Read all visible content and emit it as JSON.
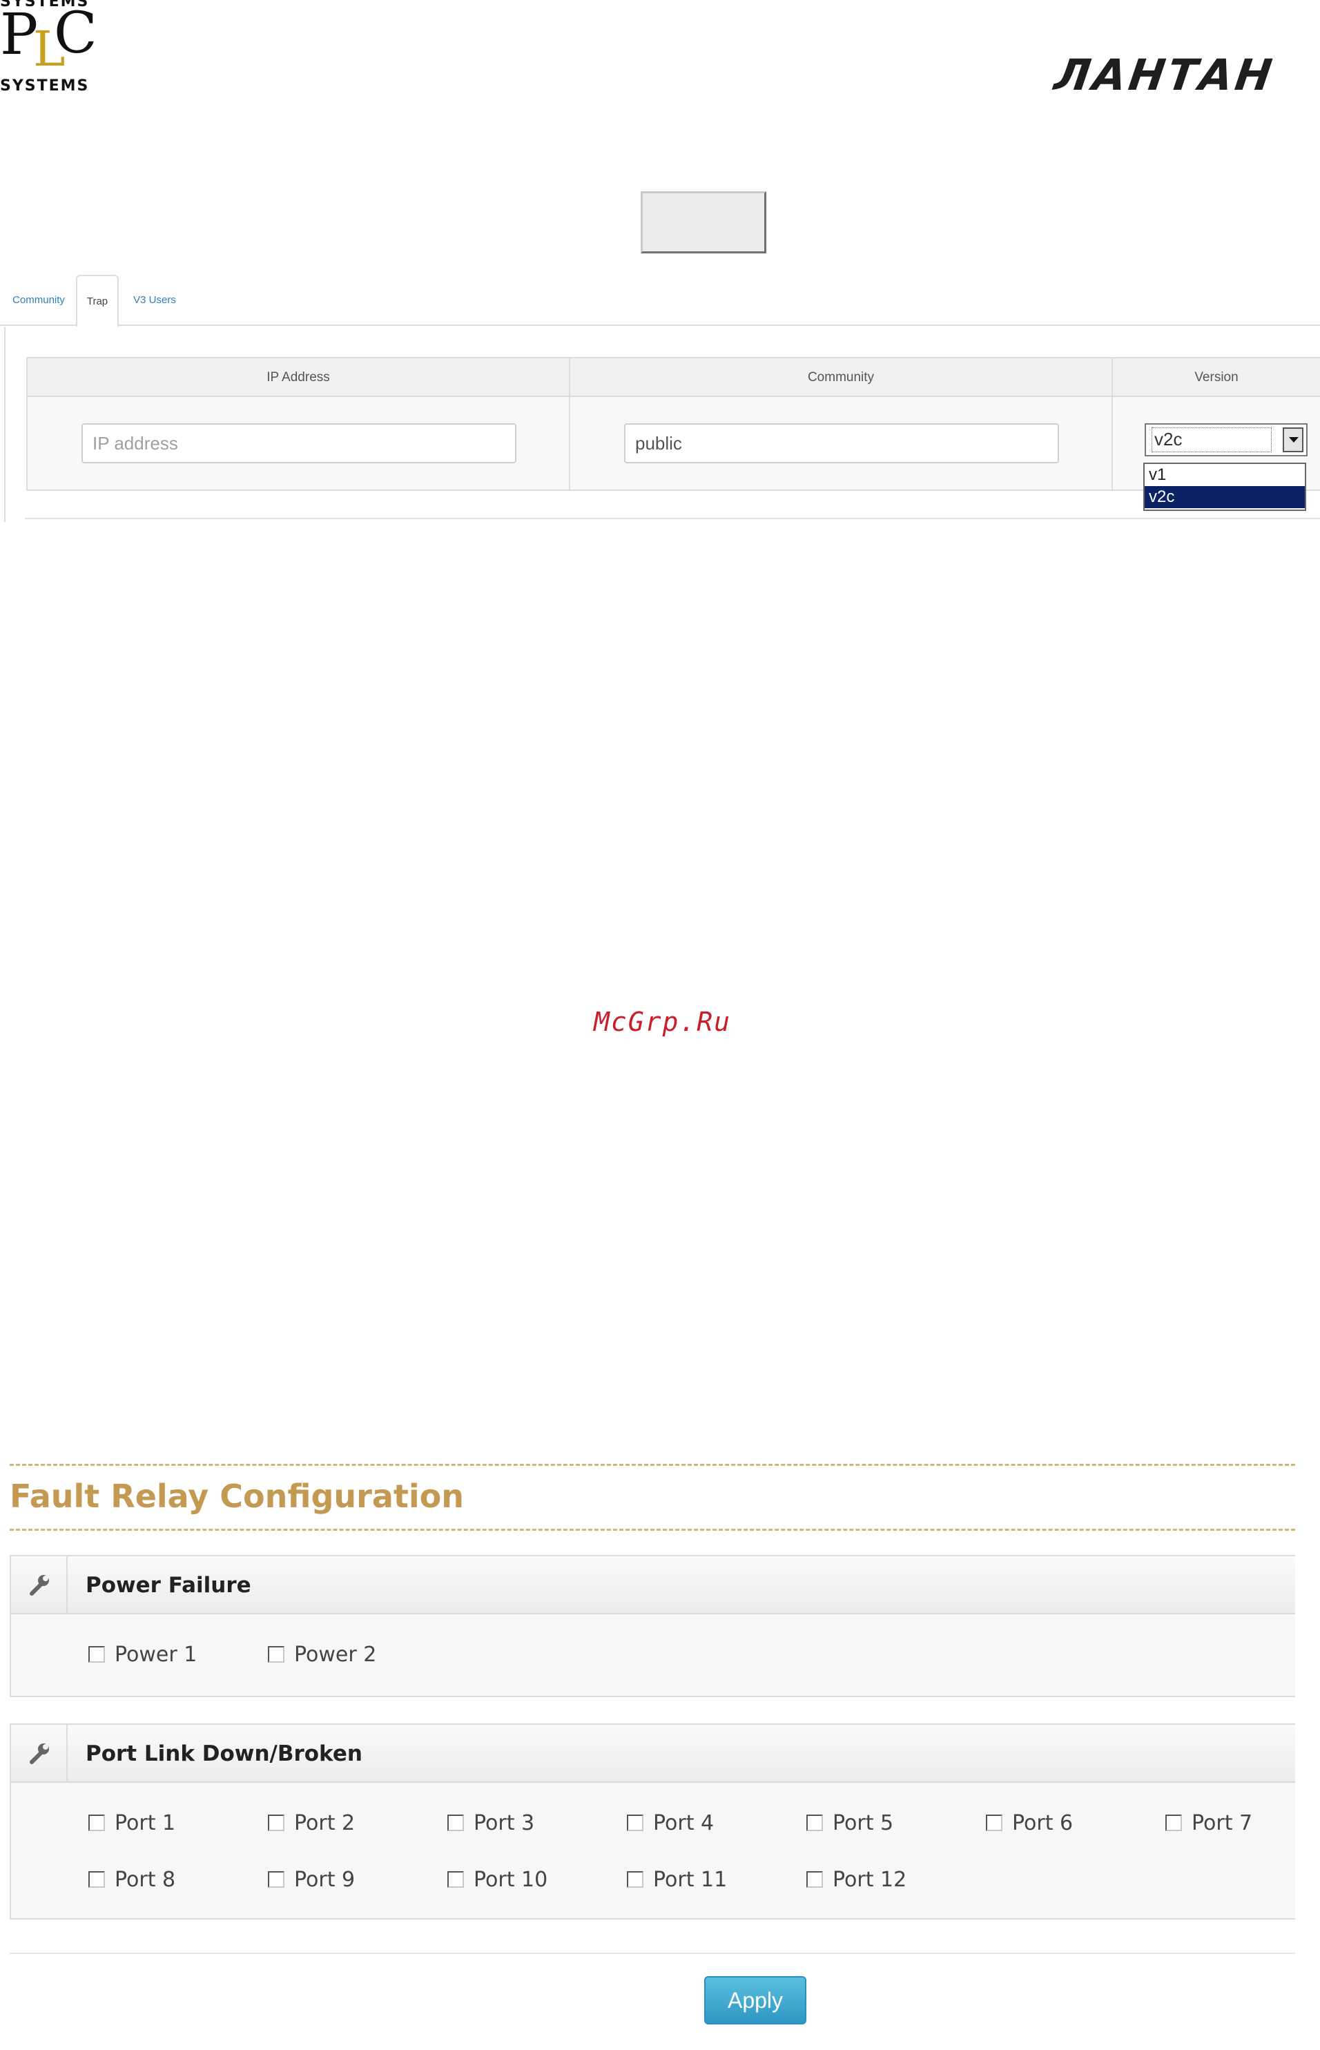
{
  "header": {
    "logo_left": {
      "top": "SYSTEMS",
      "p": "P",
      "l": "L",
      "c": "C",
      "bottom": "SYSTEMS"
    },
    "logo_right": "ЛАНТАН"
  },
  "snmp": {
    "tabs": [
      {
        "label": "Community",
        "active": false
      },
      {
        "label": "Trap",
        "active": true
      },
      {
        "label": "V3 Users",
        "active": false
      }
    ],
    "table": {
      "headers": {
        "ip": "IP Address",
        "community": "Community",
        "version": "Version"
      },
      "ip_placeholder": "IP address",
      "community_value": "public",
      "version_selected": "v2c",
      "version_options": [
        "v1",
        "v2c"
      ]
    }
  },
  "watermark": "McGrp.Ru",
  "fault_relay": {
    "title": "Fault Relay Configuration",
    "power_failure": {
      "title": "Power Failure",
      "items": [
        "Power 1",
        "Power 2"
      ]
    },
    "port_link": {
      "title": "Port Link Down/Broken",
      "items": [
        "Port 1",
        "Port 2",
        "Port 3",
        "Port 4",
        "Port 5",
        "Port 6",
        "Port 7",
        "Port 8",
        "Port 9",
        "Port 10",
        "Port 11",
        "Port 12"
      ]
    },
    "apply_label": "Apply"
  },
  "colors": {
    "accent_gold": "#c49a52",
    "link_blue": "#2d7fbf",
    "selected_option": "#0a2266",
    "apply_button": "#2f96c4",
    "watermark_red": "#c8202a"
  }
}
